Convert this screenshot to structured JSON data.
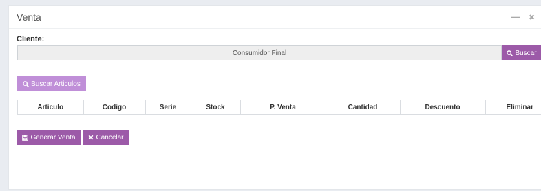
{
  "window": {
    "title": "Venta",
    "minimize_glyph": "—",
    "close_glyph": "✖"
  },
  "cliente": {
    "label": "Cliente:",
    "value": "Consumidor Final"
  },
  "buttons": {
    "buscar": "Buscar",
    "buscar_articulos": "Buscar Articulos",
    "generar_venta": "Generar Venta",
    "cancelar": "Cancelar"
  },
  "table": {
    "columns": [
      "Articulo",
      "Codigo",
      "Serie",
      "Stock",
      "P. Venta",
      "Cantidad",
      "Descuento",
      "Eliminar"
    ]
  },
  "colors": {
    "primary": "#9c5aa8",
    "primary_light": "#c08fd8"
  },
  "icons": {
    "search": "search-icon",
    "save": "save-icon",
    "cancel": "close-icon"
  }
}
